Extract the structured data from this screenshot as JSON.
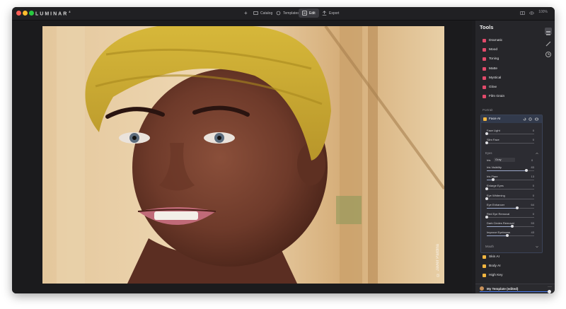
{
  "app": {
    "name": "LUMINAR",
    "version": "4"
  },
  "toolbar": {
    "add_label": "+",
    "catalog": "Catalog",
    "templates": "Templates",
    "edit": "Edit",
    "export": "Export",
    "zoom": "100%"
  },
  "photo": {
    "credit": "© Javier Pardina"
  },
  "panel": {
    "title": "Tools",
    "creative_tools": [
      {
        "label": "Dramatic",
        "icon": "dramatic-icon",
        "color": "#e24a6a"
      },
      {
        "label": "Mood",
        "icon": "mood-icon",
        "color": "#e24a6a"
      },
      {
        "label": "Toning",
        "icon": "toning-icon",
        "color": "#e24a6a"
      },
      {
        "label": "Matte",
        "icon": "matte-icon",
        "color": "#e24a6a"
      },
      {
        "label": "Mystical",
        "icon": "mystical-icon",
        "color": "#e24a6a"
      },
      {
        "label": "Glow",
        "icon": "glow-icon",
        "color": "#e24a6a"
      },
      {
        "label": "Film Grain",
        "icon": "film-grain-icon",
        "color": "#e24a6a"
      }
    ],
    "portrait_label": "Portrait",
    "face": {
      "title": "Face AI",
      "face_sliders": [
        {
          "label": "Face Light",
          "value": "0",
          "pct": 0
        },
        {
          "label": "Slim Face",
          "value": "0",
          "pct": 0
        }
      ],
      "eyes_label": "Eyes",
      "iris_label": "Iris",
      "iris_select": "Gray",
      "iris_value": "0",
      "eye_sliders": [
        {
          "label": "Iris Visibility",
          "value": "83",
          "pct": 0.83
        },
        {
          "label": "Iris Flare",
          "value": "13",
          "pct": 0.13
        },
        {
          "label": "Enlarge Eyes",
          "value": "0",
          "pct": 0
        },
        {
          "label": "Eye Whitening",
          "value": "0",
          "pct": 0
        },
        {
          "label": "Eye Enhancer",
          "value": "64",
          "pct": 0.64
        },
        {
          "label": "Red Eye Removal",
          "value": "0",
          "pct": 0
        },
        {
          "label": "Dark Circles Removal",
          "value": "53",
          "pct": 0.53
        },
        {
          "label": "Improve Eyebrows",
          "value": "43",
          "pct": 0.43
        }
      ],
      "mouth_label": "Mouth"
    },
    "more_tools": [
      {
        "label": "Skin AI",
        "icon": "skin-icon",
        "color": "#f2b640"
      },
      {
        "label": "Body AI",
        "icon": "body-icon",
        "color": "#f2b640"
      },
      {
        "label": "High Key",
        "icon": "high-key-icon",
        "color": "#f2b640"
      }
    ],
    "template": {
      "name": "My Template (edited)",
      "more": "···"
    }
  },
  "colors": {
    "accent": "#4a7cf0",
    "close": "#ff5f57",
    "minimize": "#febc2e",
    "zoom": "#28c840"
  }
}
